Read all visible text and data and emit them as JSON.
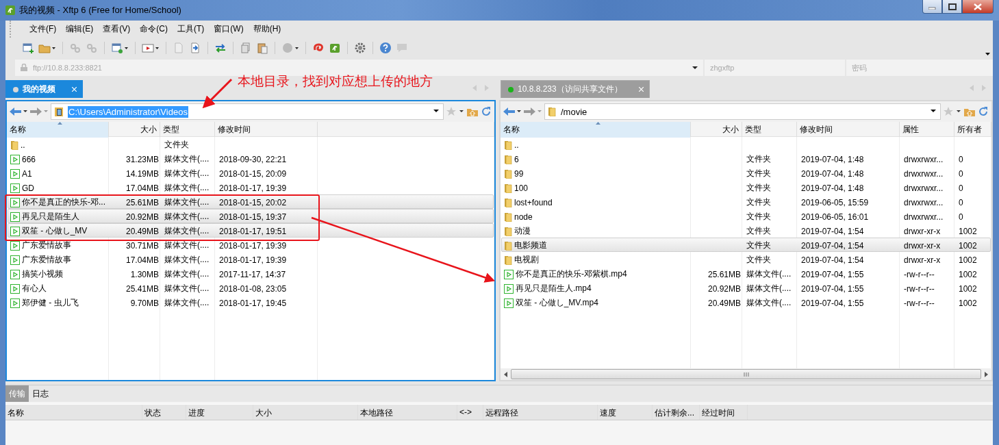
{
  "window": {
    "title": "我的视频 - Xftp 6 (Free for Home/School)"
  },
  "menu": [
    "文件(F)",
    "编辑(E)",
    "查看(V)",
    "命令(C)",
    "工具(T)",
    "窗口(W)",
    "帮助(H)"
  ],
  "address_bar": {
    "host_placeholder": "ftp://10.8.8.233:8821",
    "user_placeholder": "zhgxftp",
    "password_placeholder": "密码"
  },
  "annotation": {
    "text": "本地目录，找到对应想上传的地方"
  },
  "local_pane": {
    "tab": {
      "label": "我的视频",
      "selected": true,
      "connected": false
    },
    "path": "C:\\Users\\Administrator\\Videos",
    "path_selected": true,
    "columns": [
      {
        "label": "名称",
        "sorted": true
      },
      {
        "label": "大小",
        "sorted": false
      },
      {
        "label": "类型",
        "sorted": false
      },
      {
        "label": "修改时间",
        "sorted": false
      }
    ],
    "rows": [
      {
        "kind": "folder",
        "name": "..",
        "type": "文件夹",
        "selected": false
      },
      {
        "kind": "media",
        "name": "666",
        "size": "31.23MB",
        "type": "媒体文件(....",
        "modified": "2018-09-30, 22:21",
        "selected": false
      },
      {
        "kind": "media",
        "name": "A1",
        "size": "14.19MB",
        "type": "媒体文件(....",
        "modified": "2018-01-15, 20:09",
        "selected": false
      },
      {
        "kind": "media",
        "name": "GD",
        "size": "17.04MB",
        "type": "媒体文件(....",
        "modified": "2018-01-17, 19:39",
        "selected": false
      },
      {
        "kind": "media",
        "name": "你不是真正的快乐-邓...",
        "size": "25.61MB",
        "type": "媒体文件(....",
        "modified": "2018-01-15, 20:02",
        "selected": true
      },
      {
        "kind": "media",
        "name": "再见只是陌生人",
        "size": "20.92MB",
        "type": "媒体文件(....",
        "modified": "2018-01-15, 19:37",
        "selected": true
      },
      {
        "kind": "media",
        "name": "双笙 - 心做し_MV",
        "size": "20.49MB",
        "type": "媒体文件(....",
        "modified": "2018-01-17, 19:51",
        "selected": true
      },
      {
        "kind": "media",
        "name": "广东爱情故事",
        "size": "30.71MB",
        "type": "媒体文件(....",
        "modified": "2018-01-17, 19:39",
        "selected": false
      },
      {
        "kind": "media",
        "name": "广东爱情故事",
        "size": "17.04MB",
        "type": "媒体文件(....",
        "modified": "2018-01-17, 19:39",
        "selected": false
      },
      {
        "kind": "media",
        "name": "搞笑小视频",
        "size": "1.30MB",
        "type": "媒体文件(....",
        "modified": "2017-11-17, 14:37",
        "selected": false
      },
      {
        "kind": "media",
        "name": "有心人",
        "size": "25.41MB",
        "type": "媒体文件(....",
        "modified": "2018-01-08, 23:05",
        "selected": false
      },
      {
        "kind": "media",
        "name": "郑伊健 - 虫儿飞",
        "size": "9.70MB",
        "type": "媒体文件(....",
        "modified": "2018-01-17, 19:45",
        "selected": false
      }
    ]
  },
  "remote_pane": {
    "tab": {
      "label": "10.8.8.233（访问共享文件）",
      "selected": false,
      "connected": true
    },
    "path": "/movie",
    "path_selected": false,
    "columns": [
      {
        "label": "名称",
        "sorted": true
      },
      {
        "label": "大小",
        "sorted": false
      },
      {
        "label": "类型",
        "sorted": false
      },
      {
        "label": "修改时间",
        "sorted": false
      },
      {
        "label": "属性",
        "sorted": false
      },
      {
        "label": "所有者",
        "sorted": false
      }
    ],
    "rows": [
      {
        "kind": "folder",
        "name": "..",
        "selected": false
      },
      {
        "kind": "folder",
        "name": "6",
        "type": "文件夹",
        "modified": "2019-07-04, 1:48",
        "attributes": "drwxrwxr...",
        "owner": "0",
        "selected": false
      },
      {
        "kind": "folder",
        "name": "99",
        "type": "文件夹",
        "modified": "2019-07-04, 1:48",
        "attributes": "drwxrwxr...",
        "owner": "0",
        "selected": false
      },
      {
        "kind": "folder",
        "name": "100",
        "type": "文件夹",
        "modified": "2019-07-04, 1:48",
        "attributes": "drwxrwxr...",
        "owner": "0",
        "selected": false
      },
      {
        "kind": "folder",
        "name": "lost+found",
        "type": "文件夹",
        "modified": "2019-06-05, 15:59",
        "attributes": "drwxrwxr...",
        "owner": "0",
        "selected": false
      },
      {
        "kind": "folder",
        "name": "node",
        "type": "文件夹",
        "modified": "2019-06-05, 16:01",
        "attributes": "drwxrwxr...",
        "owner": "0",
        "selected": false
      },
      {
        "kind": "folder",
        "name": "动漫",
        "type": "文件夹",
        "modified": "2019-07-04, 1:54",
        "attributes": "drwxr-xr-x",
        "owner": "1002",
        "selected": false
      },
      {
        "kind": "folder",
        "name": "电影频道",
        "type": "文件夹",
        "modified": "2019-07-04, 1:54",
        "attributes": "drwxr-xr-x",
        "owner": "1002",
        "selected": true
      },
      {
        "kind": "folder",
        "name": "电视剧",
        "type": "文件夹",
        "modified": "2019-07-04, 1:54",
        "attributes": "drwxr-xr-x",
        "owner": "1002",
        "selected": false
      },
      {
        "kind": "media",
        "name": "你不是真正的快乐-邓紫棋.mp4",
        "size": "25.61MB",
        "type": "媒体文件(....",
        "modified": "2019-07-04, 1:55",
        "attributes": "-rw-r--r--",
        "owner": "1002",
        "selected": false
      },
      {
        "kind": "media",
        "name": "再见只是陌生人.mp4",
        "size": "20.92MB",
        "type": "媒体文件(....",
        "modified": "2019-07-04, 1:55",
        "attributes": "-rw-r--r--",
        "owner": "1002",
        "selected": false
      },
      {
        "kind": "media",
        "name": "双笙 - 心做し_MV.mp4",
        "size": "20.49MB",
        "type": "媒体文件(....",
        "modified": "2019-07-04, 1:55",
        "attributes": "-rw-r--r--",
        "owner": "1002",
        "selected": false
      }
    ]
  },
  "transfer_panel": {
    "tabs": [
      {
        "label": "传输",
        "selected": true
      },
      {
        "label": "日志",
        "selected": false
      }
    ],
    "columns": [
      "名称",
      "状态",
      "进度",
      "大小",
      "本地路径",
      "<->",
      "远程路径",
      "速度",
      "估计剩余...",
      "经过时间"
    ]
  }
}
